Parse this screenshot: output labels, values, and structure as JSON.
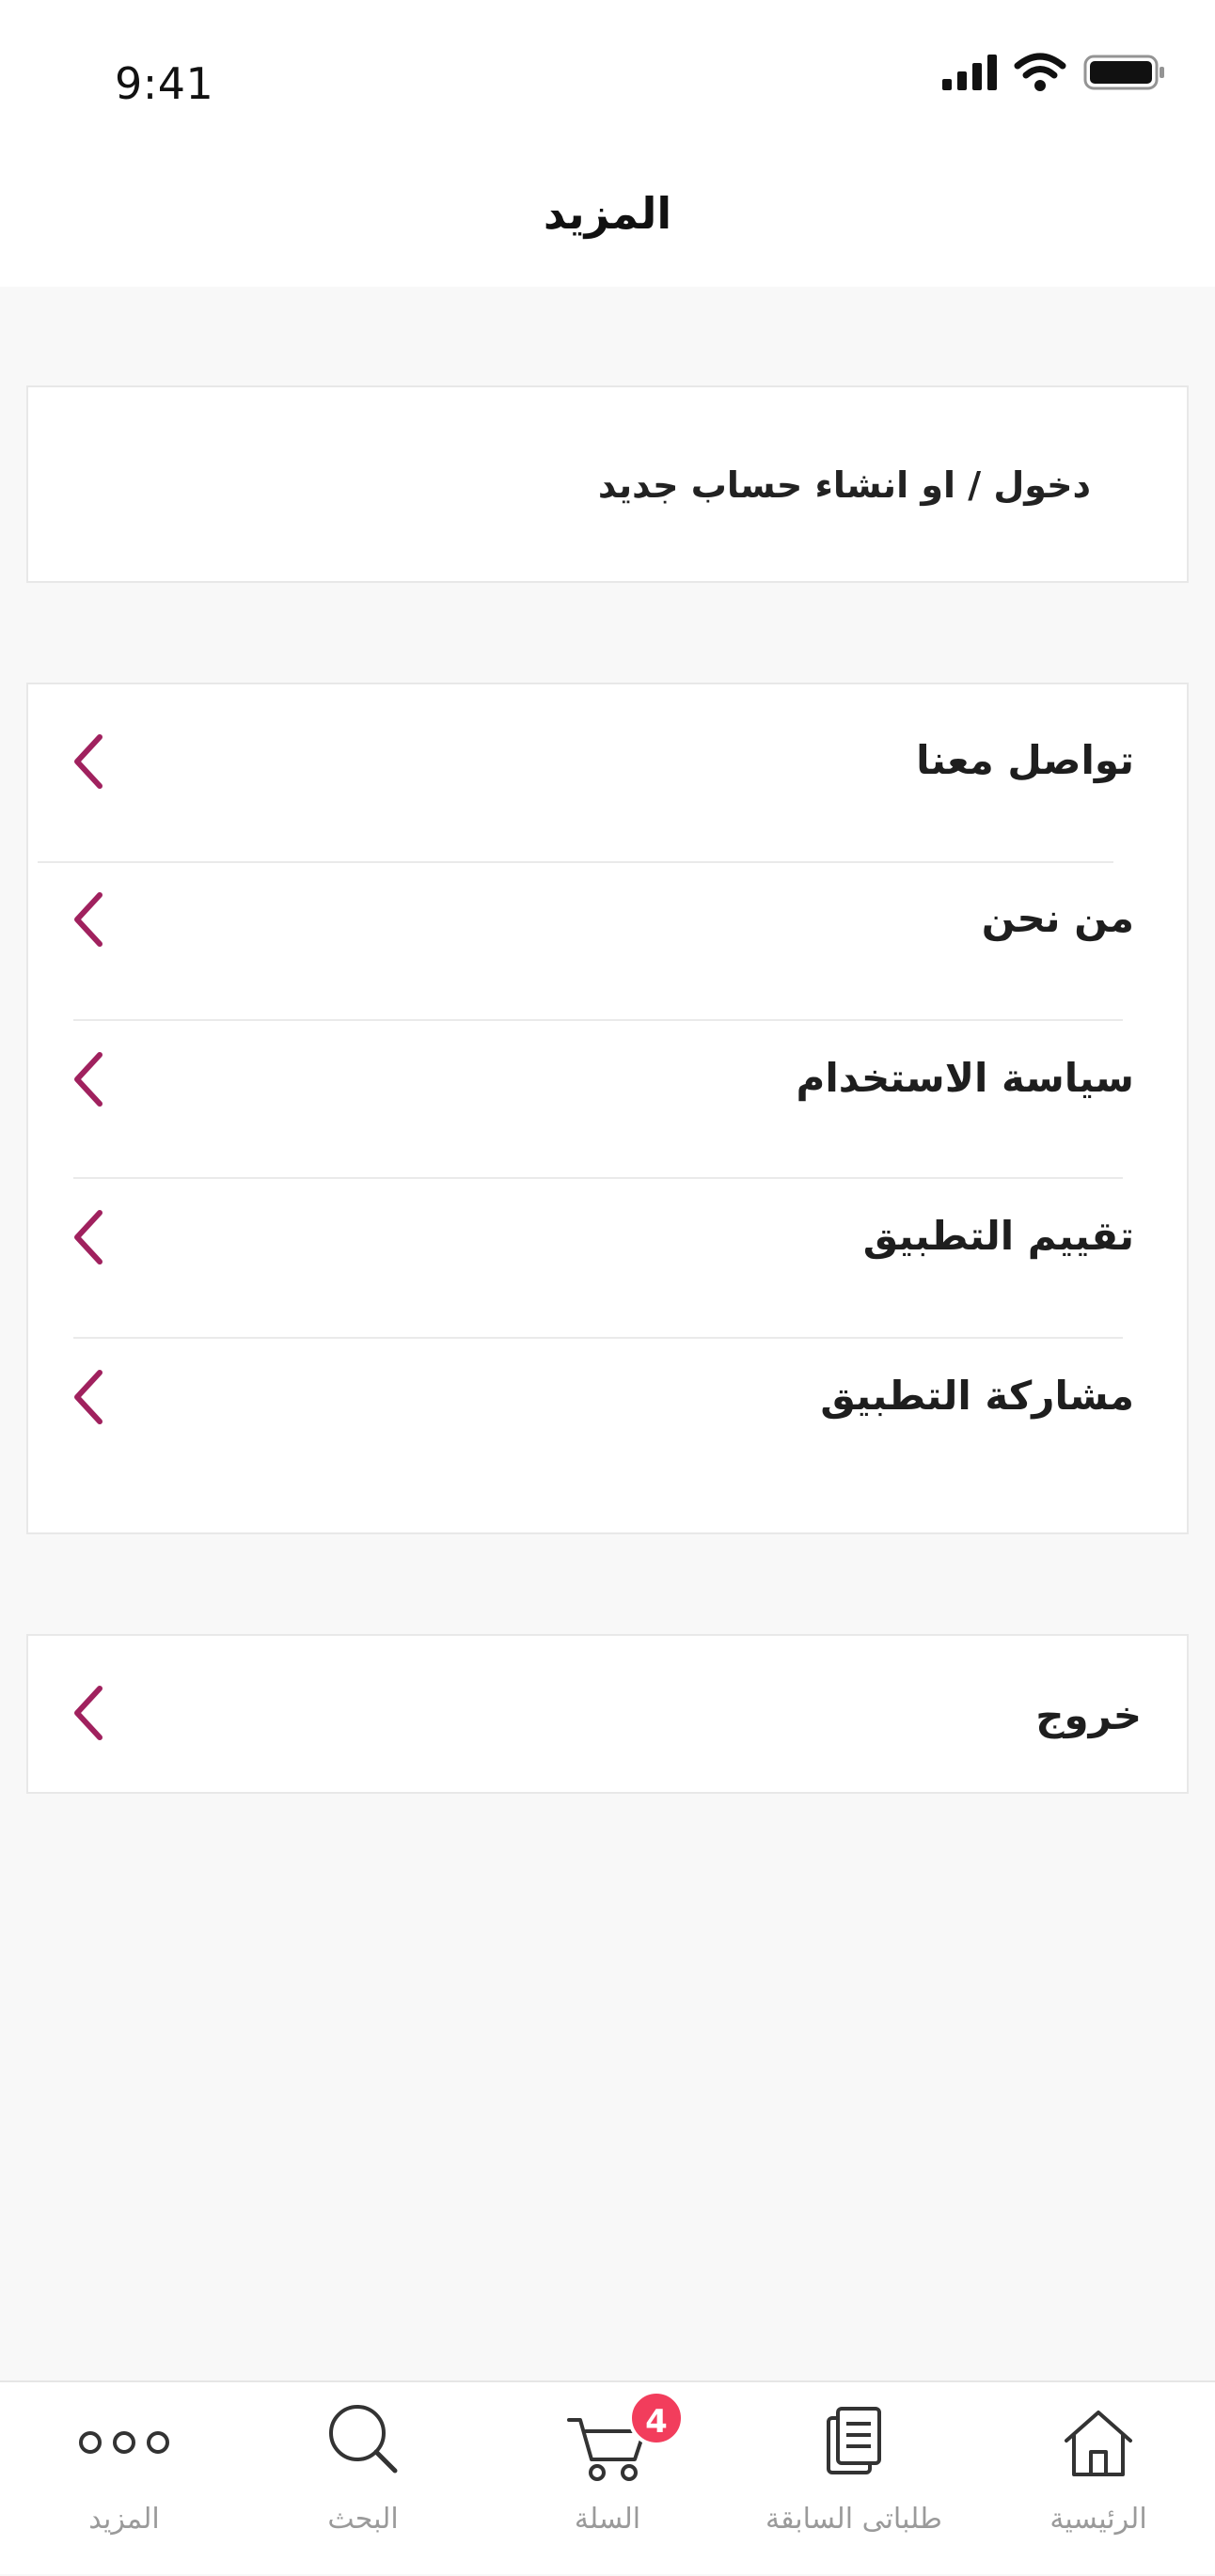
{
  "status_bar": {
    "time": "9:41"
  },
  "header": {
    "title": "المزيد"
  },
  "login": {
    "label": "دخول / او انشاء حساب جديد"
  },
  "menu": {
    "items": [
      {
        "label": "تواصل معنا"
      },
      {
        "label": "من نحن"
      },
      {
        "label": "سياسة الاستخدام"
      },
      {
        "label": "تقييم التطبيق"
      },
      {
        "label": "مشاركة التطبيق"
      }
    ]
  },
  "logout": {
    "label": "خروج"
  },
  "tabs": [
    {
      "label": "المزيد",
      "icon": "more-icon"
    },
    {
      "label": "البحث",
      "icon": "search-icon"
    },
    {
      "label": "السلة",
      "icon": "cart-icon",
      "badge": "4"
    },
    {
      "label": "طلباتى السابقة",
      "icon": "orders-icon"
    },
    {
      "label": "الرئيسية",
      "icon": "home-icon"
    }
  ],
  "colors": {
    "accent": "#a0215e",
    "badge": "#f23d5c",
    "background": "#f8f8f8"
  }
}
